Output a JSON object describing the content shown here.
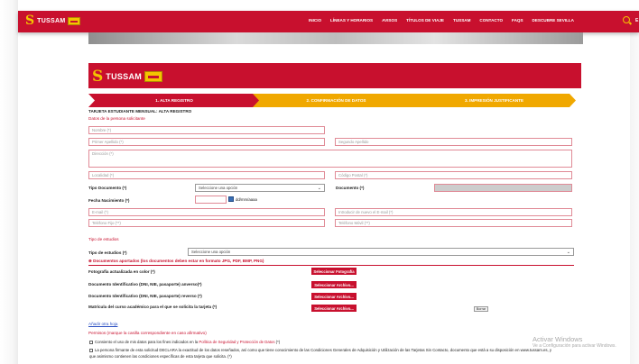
{
  "header": {
    "brand": "TUSSAM",
    "menu": [
      "INICIO",
      "LÍNEAS Y HORARIOS",
      "AVISOS",
      "TÍTULOS DE VIAJE",
      "TUSSAM",
      "CONTACTO",
      "FAQS",
      "DESCUBRE SEVILLA"
    ],
    "lang": "E"
  },
  "banner": {
    "brand": "TUSSAM"
  },
  "steps": [
    "1. ALTA REGISTRO",
    "2. CONFIRMACIÓN DE DATOS",
    "3. IMPRESIÓN JUSTIFICANTE"
  ],
  "form": {
    "title": "TARJETA ESTUDIANTE MENSUAL: ALTA REGISTRO",
    "section_personal": "Datos de la persona solicitante",
    "ph_nombre": "Nombre (*)",
    "ph_apellido1": "Primer Apellido (*)",
    "ph_apellido2": "Segundo Apellido",
    "ph_direccion": "Dirección (*)",
    "ph_localidad": "Localidad (*)",
    "ph_cp": "Código Postal (*)",
    "label_tipo_doc": "Tipo Documento (*)",
    "select_tipo_doc": "Seleccione una opción",
    "label_documento": "Documento (*)",
    "label_fecha": "Fecha Nacimiento (*)",
    "fecha_hint": "dd/mm/aaaa",
    "ph_email": "E-mail (*)",
    "ph_email2": "Introducir de nuevo el E-mail (*)",
    "ph_tel_fijo": "Teléfono Fijo (**)",
    "ph_tel_movil": "Teléfono Móvil (**)",
    "section_estudios": "Tipo de estudios",
    "label_tipo_estudios": "Tipo de estudios (*)",
    "select_tipo_estudios": "Seleccione una opción",
    "docs_header": "Documentos aportados (los documentos deben estar en formato JPG, PDF, BMP, PNG)",
    "docs": [
      {
        "label": "Fotografía actualizada en color (*)",
        "button": "Seleccionar Fotografía"
      },
      {
        "label": "Documento Identificativo (DNI, NIE, pasaporte) anverso(*)",
        "button": "Seleccionar Archivo..."
      },
      {
        "label": "Documento Identificativo (DNI, NIE, pasaporte) reverso (*)",
        "button": "Seleccionar Archivo..."
      },
      {
        "label": "Matrícula del curso académico para el que se solicita la tarjeta (*)",
        "button": "Seleccionar Archivo..."
      }
    ],
    "borrar": "Borrar",
    "add_sheet": "Añadir otra hoja",
    "permisos": "Permisos (marque la casilla correspondiente en caso afirmativo)",
    "consent1_a": "Consiento el uso de mis datos para los fines indicados en la",
    "consent1_b": "Política de Seguridad y Protección de Datos",
    "consent2_a": "La persona firmante de esta solicitud DECLARA la exactitud de los datos reseñados, así como que tiene conocimiento de las Condiciones Generales de Adquisición y Utilización de las Tarjetas Sin Contacto, documento que está a su disposición en www.tussam.es, y",
    "consent2_b": "que asimismo contienen las condiciones específicas de esta tarjeta que solicita. (*)"
  },
  "watermark": {
    "line1": "Activar Windows",
    "line2": "Ve a Configuración para activar Windows."
  },
  "colors": {
    "brand_red": "#c8102e",
    "step_yellow": "#f0a800",
    "logo_yellow": "#f3c400"
  }
}
